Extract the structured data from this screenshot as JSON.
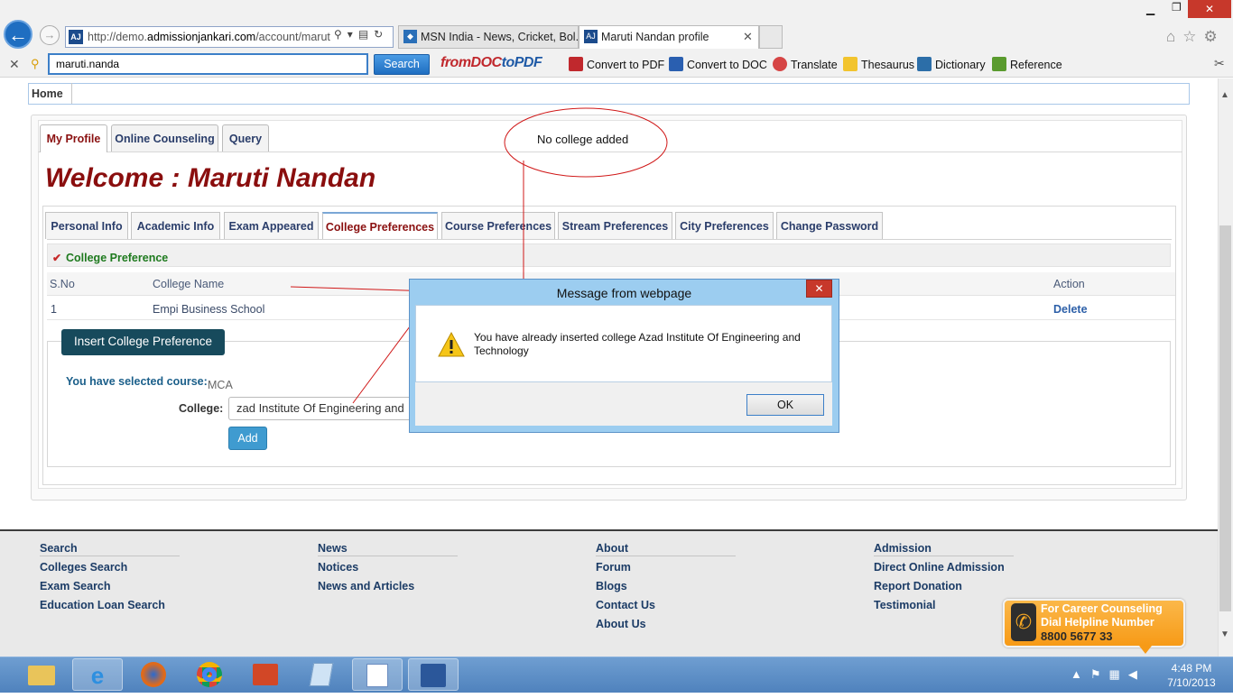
{
  "browser": {
    "address_prefix": "http://demo.",
    "address_domain": "admissionjankari.com",
    "address_path": "/account/marut",
    "favicon": "AJ",
    "tabs": [
      {
        "label": "MSN India - News, Cricket, Bol..."
      },
      {
        "label": "Maruti Nandan profile"
      }
    ],
    "window_min": "▁",
    "window_max": "❐",
    "window_close": "✕"
  },
  "toolbar": {
    "search_value": "maruti.nanda",
    "search_button": "Search",
    "logo_a": "fromDOC",
    "logo_b": "toPDF",
    "items": [
      "Convert to PDF",
      "Convert to DOC",
      "Translate",
      "Thesaurus",
      "Dictionary",
      "Reference"
    ]
  },
  "page": {
    "breadcrumb_home": "Home",
    "top_tabs": [
      "My Profile",
      "Online Counseling",
      "Query"
    ],
    "welcome": "Welcome : Maruti Nandan",
    "sub_tabs": [
      "Personal Info",
      "Academic Info",
      "Exam Appeared",
      "College Preferences",
      "Course Preferences",
      "Stream Preferences",
      "City Preferences",
      "Change Password"
    ],
    "section_title": "College Preference",
    "table": {
      "headers": [
        "S.No",
        "College Name",
        "Action"
      ],
      "rows": [
        {
          "sno": "1",
          "name": "Empi Business School",
          "action": "Delete"
        }
      ]
    },
    "insert_button": "Insert College Preference",
    "selected_course_label": "You have selected course:",
    "selected_course_value": "MCA",
    "college_label": "College:",
    "college_value": "zad Institute Of Engineering and",
    "add_button": "Add"
  },
  "annotation": {
    "text": "No college added"
  },
  "dialog": {
    "title": "Message from webpage",
    "message": "You have already inserted college Azad Institute Of Engineering and Technology",
    "ok_button": "OK",
    "close": "✕"
  },
  "footer": {
    "columns": [
      {
        "heading": "Search",
        "links": [
          "Colleges Search",
          "Exam Search",
          "Education Loan Search"
        ]
      },
      {
        "heading": "News",
        "links": [
          "Notices",
          "News and Articles"
        ]
      },
      {
        "heading": "About",
        "links": [
          "Forum",
          "Blogs",
          "Contact Us",
          "About Us"
        ]
      },
      {
        "heading": "Admission",
        "links": [
          "Direct Online Admission",
          "Report Donation",
          "Testimonial"
        ]
      }
    ],
    "helpline": {
      "line1": "For Career Counseling",
      "line2": "Dial Helpline Number",
      "number": "8800 5677 33"
    }
  },
  "taskbar": {
    "time": "4:48 PM",
    "date": "7/10/2013"
  },
  "colors": {
    "accent": "#1f6ec1",
    "welcome": "#8a0e0e",
    "footer_link": "#1c3c66",
    "dialog_frame": "#9ccdf0"
  }
}
